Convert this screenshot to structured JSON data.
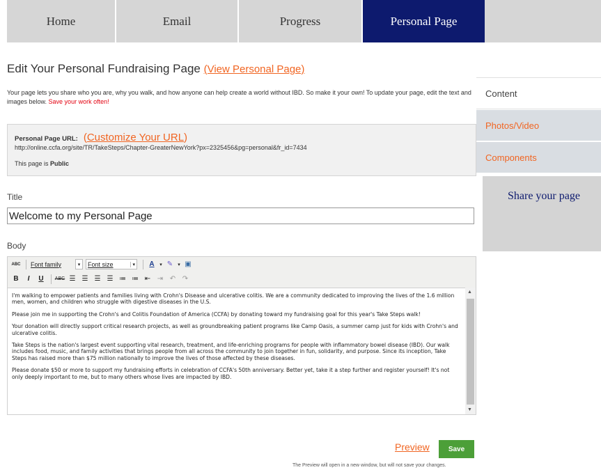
{
  "nav": {
    "tabs": [
      {
        "label": "Home"
      },
      {
        "label": "Email"
      },
      {
        "label": "Progress"
      },
      {
        "label": "Personal Page"
      }
    ]
  },
  "header": {
    "title": "Edit Your Personal Fundraising Page",
    "view_link": "(View Personal Page)"
  },
  "intro": {
    "text": "Your page lets you share who you are, why you walk, and how anyone can help create a world without IBD. So make it your own! To update your page, edit the text and images below. ",
    "warning": "Save your work often!"
  },
  "url_box": {
    "label": "Personal Page URL:",
    "customize_open": "(",
    "customize_link": "Customize Your URL",
    "customize_close": ")",
    "url": "http://online.ccfa.org/site/TR/TakeSteps/Chapter-GreaterNewYork?px=2325456&pg=personal&fr_id=7434",
    "visibility_prefix": "This page is",
    "visibility_value": "Public"
  },
  "sidebar": {
    "items": [
      {
        "label": "Content"
      },
      {
        "label": "Photos/Video"
      },
      {
        "label": "Components"
      }
    ],
    "share": "Share your page"
  },
  "form": {
    "title_label": "Title",
    "title_value": "Welcome to my Personal Page",
    "body_label": "Body"
  },
  "toolbar": {
    "font_family": "Font family",
    "font_size": "Font size",
    "bold": "B",
    "italic": "I",
    "underline": "U",
    "spell": "ABC"
  },
  "editor": {
    "paragraphs": [
      "I'm walking to empower patients and families living with Crohn's Disease and ulcerative colitis. We are a community dedicated to improving the lives of the 1.6 million men, women, and children who struggle with digestive diseases in the U.S.",
      "Please join me in supporting the Crohn's and Colitis Foundation of America (CCFA) by donating toward my fundraising goal for this year's Take Steps walk!",
      "Your donation will directly support critical research projects, as well as groundbreaking patient programs like Camp Oasis, a summer camp just for kids with Crohn's and ulcerative colitis.",
      "Take Steps is the nation's largest event supporting vital research, treatment, and life-enriching programs for people with inflammatory bowel disease (IBD). Our walk includes food, music, and family activities that brings people from all across the community to join together in fun, solidarity, and purpose. Since its inception, Take Steps has raised more than $75 million nationally to improve the lives of those affected by these diseases.",
      "Please donate $50 or more to support my fundraising efforts in celebration of CCFA's 50th anniversary. Better yet, take it a step further and register yourself! It's not only deeply important to me, but to many others whose lives are impacted by IBD."
    ]
  },
  "actions": {
    "preview": "Preview",
    "save": "Save",
    "note": "The Preview will open in a new window, but will not save your changes."
  },
  "colors": {
    "nav_active": "#0d1a6e",
    "link": "#f16522",
    "save": "#4c9f38",
    "warning": "#e3000f"
  }
}
